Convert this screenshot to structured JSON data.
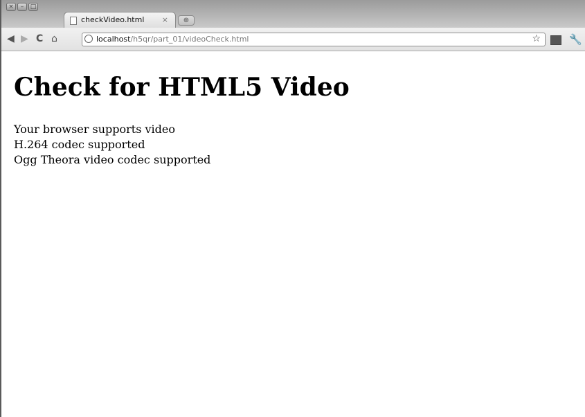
{
  "browser": {
    "window_controls": [
      "×",
      "–",
      "□"
    ],
    "tab": {
      "title": "checkVideo.html",
      "close": "×"
    },
    "new_tab": "⊕",
    "nav": {
      "back": "◀",
      "forward": "▶",
      "reload": "C",
      "home": "⌂"
    },
    "address": {
      "host": "localhost",
      "path": "/h5qr/part_01/videoCheck.html"
    },
    "icons": {
      "bookmark": "☆",
      "wrench": "🔧"
    }
  },
  "page": {
    "heading": "Check for HTML5 Video",
    "messages": [
      "Your browser supports video",
      "H.264 codec supported",
      "Ogg Theora video codec supported"
    ]
  }
}
